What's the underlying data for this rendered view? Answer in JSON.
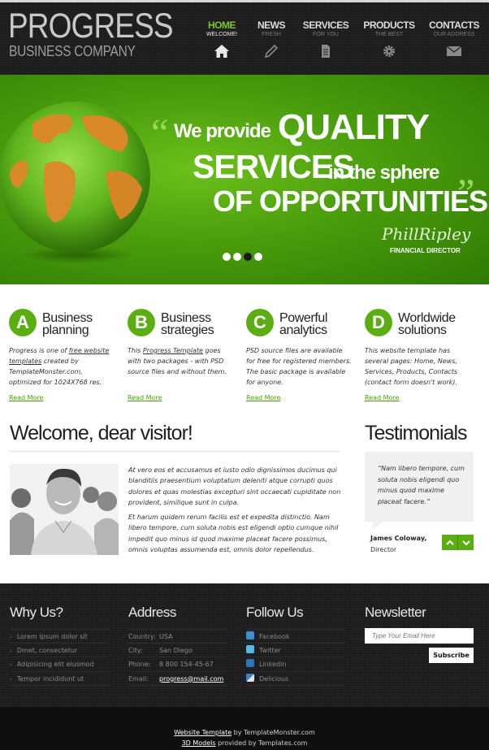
{
  "header": {
    "logo_title": "PROGRESS",
    "logo_subtitle": "BUSINESS COMPANY",
    "nav": [
      {
        "label": "HOME",
        "sub": "WELCOME!",
        "icon": "home-icon",
        "active": true
      },
      {
        "label": "NEWS",
        "sub": "FRESH",
        "icon": "pencil-icon",
        "active": false
      },
      {
        "label": "SERVICES",
        "sub": "FOR YOU",
        "icon": "document-icon",
        "active": false
      },
      {
        "label": "PRODUCTS",
        "sub": "THE BEST",
        "icon": "gear-icon",
        "active": false
      },
      {
        "label": "CONTACTS",
        "sub": "OUR ADDRESS",
        "icon": "envelope-icon",
        "active": false
      }
    ]
  },
  "slider": {
    "quote_open": "“",
    "quote_close": "”",
    "line1_small": "We provide",
    "line1_big": "QUALITY",
    "line2_big": "SERVICES",
    "line2_small": "in the sphere",
    "line3": "OF OPPORTUNITIES",
    "signature": "PhillRipley",
    "signature_title": "FINANCIAL DIRECTOR",
    "slide_count": 4,
    "active_slide": 3
  },
  "features": [
    {
      "letter": "A",
      "title1": "Business",
      "title2": "planning",
      "desc_a": "Progress is one of ",
      "desc_link": "free website templates",
      "desc_b": " created by TemplateMonster.com, optimized for 1024X768 res.",
      "link": "Read More"
    },
    {
      "letter": "B",
      "title1": "Business",
      "title2": "strategies",
      "desc_a": "This ",
      "desc_link": "Progress Template",
      "desc_b": " goes with two packages - with PSD source files and without them.",
      "link": "Read More"
    },
    {
      "letter": "C",
      "title1": "Powerful",
      "title2": "analytics",
      "desc_a": "PSD source files are available for free for registered members. The basic package is available for anyone.",
      "desc_link": "",
      "desc_b": "",
      "link": "Read More"
    },
    {
      "letter": "D",
      "title1": "Worldwide",
      "title2": "solutions",
      "desc_a": "This website template has several pages: Home, News, Services, Products, Contacts (contact form doesn't work).",
      "desc_link": "",
      "desc_b": "",
      "link": "Read More"
    }
  ],
  "welcome": {
    "heading": "Welcome, dear visitor!",
    "p1": "At vero eos et accusamus et iusto odio dignissimos ducimus qui blanditiis praesentium voluptatum deleniti atque corrupti quos dolores et quas molestias excepturi sint occaecati cupiditate non provident, similique sunt in culpa.",
    "p2": "Et harum quidem rerum facilis est et expedita distinctio. Nam libero tempore, cum soluta nobis est eligendi optio cumque nihil impedit quo minus id quod maxime placeat facere possimus, omnis voluptas assumenda est, omnis dolor repellendus."
  },
  "testimonials": {
    "heading": "Testimonials",
    "quote": "“Nam libero tempore, cum soluta nobis eligendi quo minus quod maxime placeat facere.”",
    "author": "James Coloway,",
    "role": "Director"
  },
  "footer": {
    "why_heading": "Why Us?",
    "why_items": [
      "Lorem ipsum dolor sit",
      "Dmet, consectetur",
      "Adipisicing elit eiusmod",
      "Tempor incididunt ut"
    ],
    "address_heading": "Address",
    "address": [
      {
        "label": "Country:",
        "value": "USA"
      },
      {
        "label": "City:",
        "value": "San Diego"
      },
      {
        "label": "Phone:",
        "value": "8 800 154-45-67"
      },
      {
        "label": "Email:",
        "value": "progress@mail.com"
      }
    ],
    "follow_heading": "Follow Us",
    "follow": [
      {
        "label": "Facebook",
        "icon": "facebook-icon",
        "color": "#3b8fd6"
      },
      {
        "label": "Twitter",
        "icon": "twitter-icon",
        "color": "#55b9e8"
      },
      {
        "label": "Linkedin",
        "icon": "linkedin-icon",
        "color": "#2f73b8"
      },
      {
        "label": "Delicious",
        "icon": "delicious-icon",
        "color": "#3f7fd0"
      }
    ],
    "newsletter_heading": "Newsletter",
    "newsletter_placeholder": "Type Your Email Here",
    "subscribe": "Subscribe",
    "copy1_link": "Website Template",
    "copy1_text": " by TemplateMonster.com",
    "copy2_link": "3D Models",
    "copy2_text": " provided by Templates.com"
  },
  "colors": {
    "accent": "#5bae11",
    "header_bg": "#1c1c1c",
    "slider_green": "#4a9d0c",
    "active_nav": "#7bc52c"
  }
}
